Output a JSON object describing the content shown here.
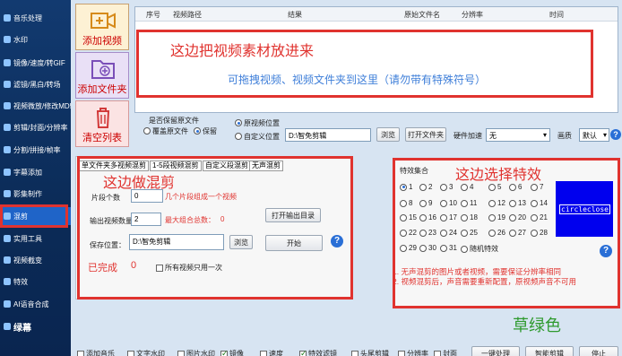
{
  "sidebar": {
    "items": [
      {
        "label": "音乐处理"
      },
      {
        "label": "水印"
      },
      {
        "label": "镜像/速度/转GIF"
      },
      {
        "label": "滤镜/黑白/转场"
      },
      {
        "label": "视频微放/修改MD5"
      },
      {
        "label": "剪辑/封面/分辨率"
      },
      {
        "label": "分割/拼接/帧率"
      },
      {
        "label": "字幕添加"
      },
      {
        "label": "影集制作"
      },
      {
        "label": "混剪"
      },
      {
        "label": "实用工具"
      },
      {
        "label": "视频截变"
      },
      {
        "label": "特效"
      },
      {
        "label": "AI语音合成"
      },
      {
        "label": "绿幕"
      }
    ],
    "active": "混剪"
  },
  "top_buttons": {
    "add_video": "添加视频",
    "add_folder": "添加文件夹",
    "clear_list": "清空列表"
  },
  "file_table": {
    "columns": [
      "序号",
      "视频路径",
      "结果",
      "原始文件名",
      "分辨率",
      "时间"
    ]
  },
  "annotations": {
    "drop_title": "这边把视频素材放进来",
    "drop_hint": "可拖拽视频、视频文件夹到这里（请勿带有特殊符号）",
    "left_title": "这边做混剪",
    "right_title": "这边选择特效",
    "green_label": "草绿色"
  },
  "output": {
    "keep_original_label": "是否保留原文件",
    "overwrite_label": "覆盖原文件",
    "keep_label": "保留",
    "original_location_label": "原视频位置",
    "custom_location_label": "自定义位置",
    "path_value": "D:\\智免剪辑",
    "browse": "浏览",
    "open_folder": "打开文件夹",
    "hw_accel_label": "硬件加速",
    "hw_accel_value": "无",
    "quality_label": "画质",
    "quality_value": "默认"
  },
  "mix_panel": {
    "tabs": [
      "单文件夹多视频混剪",
      "1-5段视频混剪",
      "自定义段混剪",
      "无声混剪"
    ],
    "segments_label": "片段个数",
    "segments_value": "0",
    "segments_hint": "几个片段组成一个视频",
    "output_count_label": "输出视频数量",
    "output_count_value": "2",
    "max_combos_label": "最大组合总数：",
    "max_combos_value": "0",
    "open_output_dir": "打开输出目录",
    "save_location_label": "保存位置：",
    "save_location_value": "D:\\智免剪辑",
    "browse": "浏览",
    "start": "开始",
    "done_label": "已完成",
    "done_value": "0",
    "use_once_label": "所有视频只用一次"
  },
  "effects_panel": {
    "title": "特效集合",
    "options": [
      "1",
      "2",
      "3",
      "4",
      "5",
      "6",
      "7",
      "8",
      "9",
      "10",
      "11",
      "12",
      "13",
      "14",
      "15",
      "16",
      "17",
      "18",
      "19",
      "20",
      "21",
      "22",
      "23",
      "24",
      "25",
      "26",
      "27",
      "28",
      "29",
      "30",
      "31",
      "随机特效"
    ],
    "selected": "1",
    "preview_text": "circleclose",
    "note_1": "1. 无声混剪的图片或者视频，需要保证分辨率相同",
    "note_2": "2. 视频混剪后，声音需要重新配置，原视频声音不可用"
  },
  "bottom_bar": {
    "checks": [
      {
        "label": "添加音乐",
        "checked": false
      },
      {
        "label": "文字水印",
        "checked": false
      },
      {
        "label": "图片水印",
        "checked": false
      },
      {
        "label": "镜像",
        "checked": true
      },
      {
        "label": "速度",
        "checked": false
      },
      {
        "label": "特效滤镜",
        "checked": true
      },
      {
        "label": "头尾剪辑",
        "checked": false
      },
      {
        "label": "分辨率",
        "checked": false
      },
      {
        "label": "封面",
        "checked": false
      }
    ],
    "one_click": "一键处理",
    "smart_cut": "智能剪辑",
    "stop": "停止"
  },
  "colors": {
    "accent": "#e0332f",
    "hint_blue": "#3f7fd9",
    "green_label": "#2e9a2e",
    "sidebar_bg": "#0b2b57",
    "preview_bg": "#0000ee"
  }
}
